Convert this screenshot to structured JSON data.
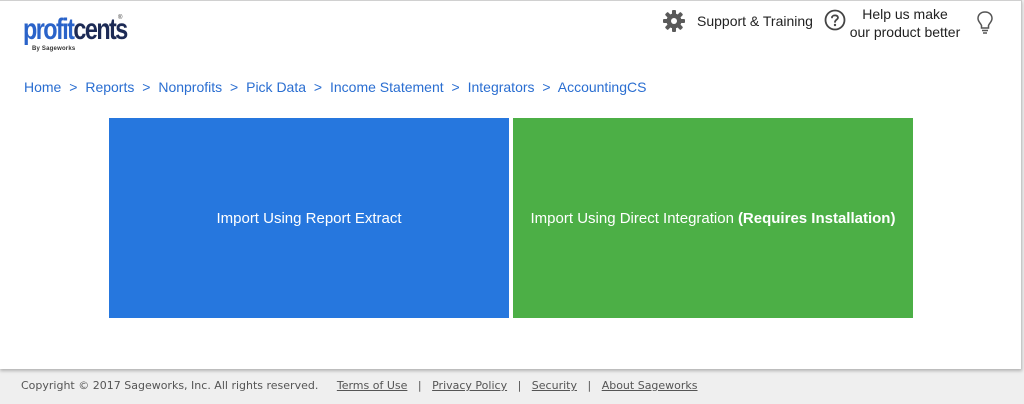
{
  "header": {
    "logo": {
      "word_a": "profit",
      "word_b": "cents",
      "tagline": "By Sageworks",
      "tm": "®"
    },
    "support_label": "Support & Training",
    "help_line1": "Help us make",
    "help_line2": "our product better"
  },
  "breadcrumb": [
    "Home",
    "Reports",
    "Nonprofits",
    "Pick Data",
    "Income Statement",
    "Integrators",
    "AccountingCS"
  ],
  "breadcrumb_separator": ">",
  "tiles": {
    "report_extract": {
      "label": "Import Using Report Extract",
      "color": "#2677de"
    },
    "direct_integration": {
      "label": "Import Using Direct Integration",
      "note": "(Requires Installation)",
      "color": "#4caf46"
    }
  },
  "footer": {
    "copyright": "Copyright © 2017 Sageworks, Inc. All rights reserved.",
    "links": [
      "Terms of Use",
      "Privacy Policy",
      "Security",
      "About Sageworks"
    ],
    "separator": "|"
  }
}
